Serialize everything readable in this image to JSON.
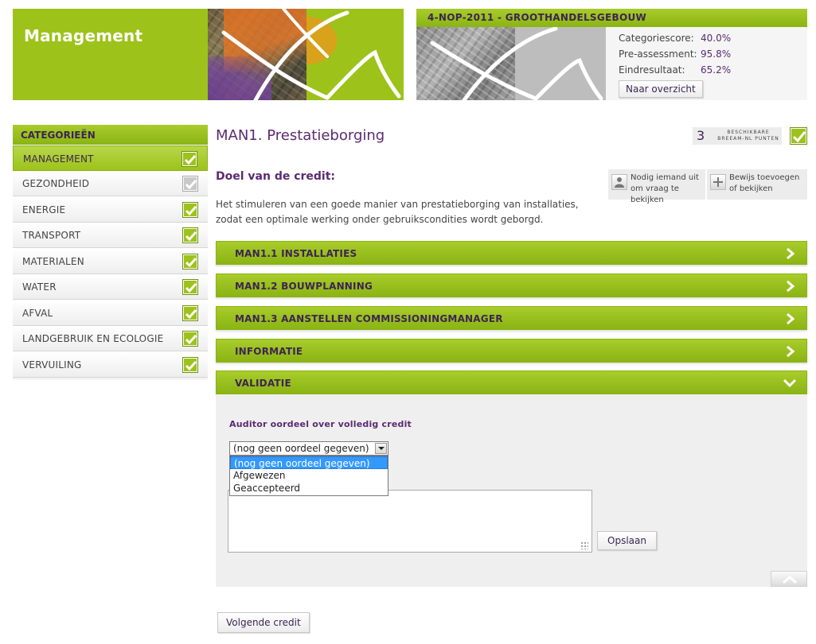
{
  "header": {
    "title": "Management",
    "project_title": "4-NOP-2011 - GROOTHANDELSGEBOUW",
    "stats": [
      {
        "label": "Categoriescore:",
        "value": "40.0%"
      },
      {
        "label": "Pre-assessment:",
        "value": "95.8%"
      },
      {
        "label": "Eindresultaat:",
        "value": "65.2%"
      }
    ],
    "overview_button": "Naar overzicht"
  },
  "sidebar": {
    "heading": "CATEGORIEËN",
    "items": [
      {
        "label": "MANAGEMENT",
        "active": true,
        "checked": true
      },
      {
        "label": "GEZONDHEID",
        "active": false,
        "checked": false
      },
      {
        "label": "ENERGIE",
        "active": false,
        "checked": true
      },
      {
        "label": "TRANSPORT",
        "active": false,
        "checked": true
      },
      {
        "label": "MATERIALEN",
        "active": false,
        "checked": true
      },
      {
        "label": "WATER",
        "active": false,
        "checked": true
      },
      {
        "label": "AFVAL",
        "active": false,
        "checked": true
      },
      {
        "label": "LANDGEBRUIK EN ECOLOGIE",
        "active": false,
        "checked": true
      },
      {
        "label": "VERVUILING",
        "active": false,
        "checked": true
      }
    ]
  },
  "main": {
    "title": "MAN1. Prestatieborging",
    "points": {
      "value": "3",
      "label_line1": "BESCHIKBARE",
      "label_line2": "BREEAM-NL PUNTEN"
    },
    "goal_heading": "Doel van de credit:",
    "goal_text": "Het stimuleren van een goede manier van prestatieborging van installaties, zodat een optimale werking onder gebruikscondities wordt geborgd.",
    "help_buttons": [
      {
        "label": "Nodig iemand uit om vraag te bekijken",
        "icon": "person-icon"
      },
      {
        "label": "Bewijs toevoegen of bekijken",
        "icon": "plus-icon"
      }
    ],
    "accordion": [
      {
        "label": "MAN1.1 INSTALLATIES",
        "expanded": false
      },
      {
        "label": "MAN1.2 BOUWPLANNING",
        "expanded": false
      },
      {
        "label": "MAN1.3 AANSTELLEN COMMISSIONINGMANAGER",
        "expanded": false
      },
      {
        "label": "INFORMATIE",
        "expanded": false
      },
      {
        "label": "VALIDATIE",
        "expanded": true
      }
    ],
    "validation": {
      "label": "Auditor oordeel over volledig credit",
      "selected": "(nog geen oordeel gegeven)",
      "options": [
        "(nog geen oordeel gegeven)",
        "Afgewezen",
        "Geaccepteerd"
      ],
      "save_button": "Opslaan"
    },
    "next_button": "Volgende credit"
  },
  "colors": {
    "accent_green": "#9dc21a",
    "brand_purple": "#5b2a73",
    "highlight_blue": "#3399ff"
  }
}
